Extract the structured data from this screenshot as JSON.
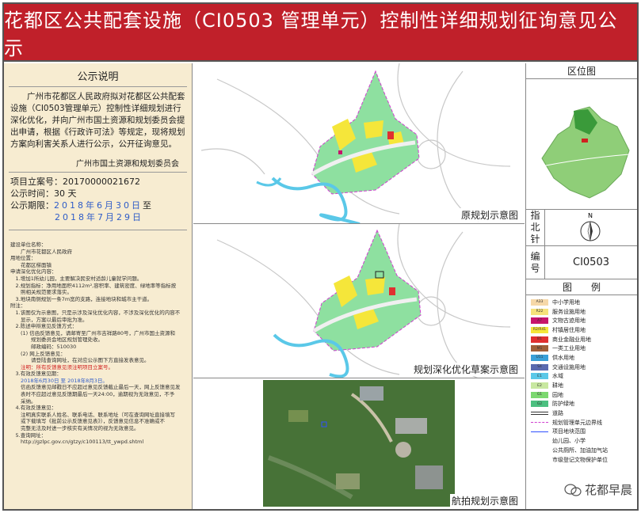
{
  "header": {
    "title": "花都区公共配套设施（CI0503 管理单元）控制性详细规划征询意见公示"
  },
  "notice": {
    "section_title": "公示说明",
    "intro": "广州市花都区人民政府拟对花都区公共配套设施（CI0503管理单元）控制性详细规划进行深化优化，并向广州市国土资源和规划委员会提出申请，根据《行政许可法》等规定，现将规划方案向利害关系人进行公示，公开征询意见。",
    "org": "广州市国土资源和规划委员会",
    "project_no_label": "项目立案号：",
    "project_no": "20170000021672",
    "duration_label": "公示时间：",
    "duration": "30 天",
    "period_label": "公示期限：",
    "period_start": "2018年6月30日",
    "period_to": "至",
    "period_end": "2018年7月29日"
  },
  "fine_print": [
    "建设单位名称：",
    "　　广州市花都区人民政府",
    "用地位置：",
    "　　花都区梯面镇",
    "申请深化优化内容：",
    "　1.增加1所幼儿园，主要解决民安村适龄儿童就学问题。",
    "　2.规划指标：净用地面积4112m²,容积率、建筑密度、绿地率等指标按",
    "　　照相关规范要求落实。",
    "　3.地块南侧规划一条7m宽的支路，连接地块和城市主干道。",
    "附注：",
    "　1.该图仅为示意图，只是示涉及深化优化内容，不涉及深化优化的内容不",
    "　　显示，方案以最后审批为准。",
    "　2.陈述申辩意见反馈方式：",
    "　　(1) 信函反馈意见，请邮寄至广州市吉祥路80号，广州市国土资源和",
    "　　　　规划委员会地区规划管理处收。",
    "　　　　邮政编码：510030",
    "　　(2) 网上反馈意见：",
    "　　　　请登陆查询网址，在对应公示图下方直接发表意见。"
  ],
  "fine_note": "　　注明：所有反馈意见须注明项目立案号。",
  "fine_print_2": [
    "　3.有效反馈意见期：",
    "　　信函反馈意见邮戳日不应超过意见反馈截止最后一天，网上反馈意见发",
    "　　表时不应超过意见反馈期最后一天24:00，逾期视为无效意见，不予",
    "　　采纳。",
    "　4.有效反馈意见：",
    "　　注明真实联系人姓名、联系电话、联系地址（可在查询网址直接填写",
    "　　或下载填写《批前公示反馈意见表》），反馈意见信息不准确或不",
    "　　完整无法及时进一步核实有关情况的视为无效意见。",
    "　5.查询网址：",
    "　　http://gzlpc.gov.cn/gtzy/c100113/tt_ywpd.shtml"
  ],
  "fine_date_line": {
    "pre": "　　2018年6月30日 至 2018年8月3日。"
  },
  "maps": {
    "original_caption": "原规划示意图",
    "draft_caption": "规划深化优化草案示意图",
    "aerial_caption": "航拍规划示意图"
  },
  "right": {
    "location_title": "区位图",
    "north_label": [
      "指",
      "北",
      "针"
    ],
    "north_letter": "N",
    "code_label": [
      "编",
      "号"
    ],
    "code": "CI0503",
    "legend_title": "图　　例",
    "legend": [
      {
        "code": "A33",
        "label": "中小学用地",
        "color": "#f6d8a8"
      },
      {
        "code": "R22",
        "label": "服务设施用地",
        "color": "#f6e27a"
      },
      {
        "code": "A7",
        "label": "文物古迹用地",
        "color": "#c7156b"
      },
      {
        "code": "R2/R41",
        "label": "村镇居住用地",
        "color": "#f5e63a"
      },
      {
        "code": "B1",
        "label": "商业金融业用地",
        "color": "#e03030"
      },
      {
        "code": "M1",
        "label": "一类工业用地",
        "color": "#a0603a"
      },
      {
        "code": "U11",
        "label": "供水用地",
        "color": "#3aa0d8"
      },
      {
        "code": "S4",
        "label": "交通设施用地",
        "color": "#5a6ab0"
      },
      {
        "code": "E1",
        "label": "水域",
        "color": "#5ac8e8"
      },
      {
        "code": "E2",
        "label": "耕地",
        "color": "#c8e8a0"
      },
      {
        "code": "G1",
        "label": "园地",
        "color": "#7cd870"
      },
      {
        "code": "G2",
        "label": "防护绿地",
        "color": "#4cc080"
      },
      {
        "code": "",
        "label": "道路",
        "color": "#ffffff"
      },
      {
        "code": "",
        "label": "规划管理单元边界线",
        "color": "#ffffff"
      },
      {
        "code": "",
        "label": "项目地块范围",
        "color": "#ffffff"
      },
      {
        "code": "",
        "label": "幼儿园、小学",
        "color": "#ffffff"
      },
      {
        "code": "",
        "label": "公共厕所、加油加气站",
        "color": "#ffffff"
      },
      {
        "code": "",
        "label": "市级登记文物保护单位",
        "color": "#ffffff"
      }
    ]
  },
  "watermark": "花都早晨"
}
